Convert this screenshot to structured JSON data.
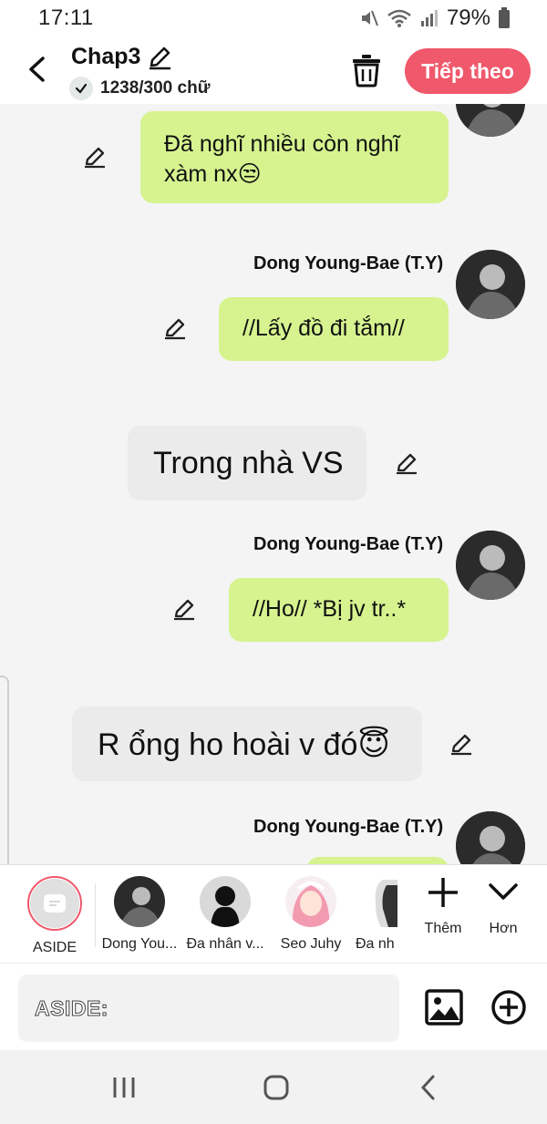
{
  "status": {
    "time": "17:11",
    "battery": "79%"
  },
  "header": {
    "title": "Chap3",
    "word_count": "1238/300 chữ",
    "next_label": "Tiếp theo"
  },
  "messages": [
    {
      "type": "right",
      "text": "Đã nghĩ nhiều còn nghĩ xàm nx😒",
      "line1": "Đã nghĩ nhiều còn nghĩ",
      "line2": "xàm nx😒"
    },
    {
      "type": "right",
      "sender": "Dong Young-Bae (T.Y)",
      "text": "//Lấy đồ đi tắm//"
    },
    {
      "type": "aside",
      "text": "Trong nhà VS"
    },
    {
      "type": "right",
      "sender": "Dong Young-Bae (T.Y)",
      "text": "//Ho// *Bị jv tr..*"
    },
    {
      "type": "aside",
      "text": "R ổng ho hoài v đó😇"
    },
    {
      "type": "right",
      "sender": "Dong Young-Bae (T.Y)",
      "text": ""
    }
  ],
  "characters": [
    {
      "label": "ASIDE"
    },
    {
      "label": "Dong You..."
    },
    {
      "label": "Đa nhân v..."
    },
    {
      "label": "Seo Juhy"
    },
    {
      "label": "Đa nh"
    }
  ],
  "tools": {
    "add_label": "Thêm",
    "more_label": "Hơn"
  },
  "input": {
    "label": "ASIDE:"
  },
  "colors": {
    "accent": "#f0586b",
    "bubble_green": "#d6f38f",
    "bubble_gray": "#ebebeb"
  }
}
